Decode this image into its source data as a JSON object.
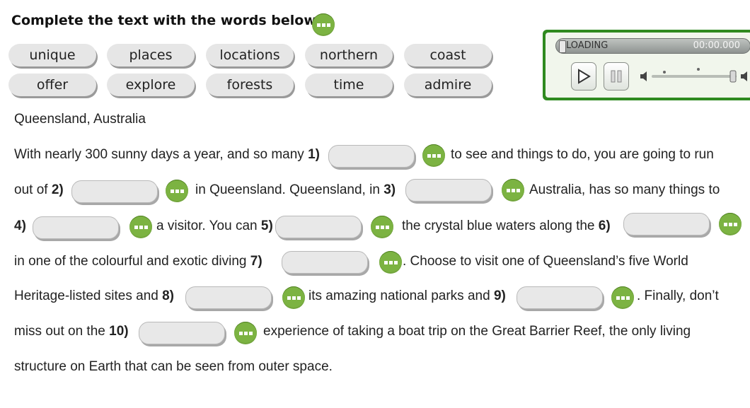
{
  "instruction": "Complete the text with the words below.",
  "word_bank": [
    [
      "unique",
      "places",
      "locations",
      "northern",
      "coast"
    ],
    [
      "offer",
      "explore",
      "forests",
      "time",
      "admire"
    ]
  ],
  "player": {
    "status": "LOADING",
    "time": "00:00.000"
  },
  "heading": "Queensland, Australia",
  "lines": {
    "l1": {
      "a": "With nearly 300 sunny days a year, and so many ",
      "n1": "1)",
      "b": "to see and things to do, you are going to run"
    },
    "l2": {
      "a": "out of ",
      "n2": "2)",
      "b": "in Queensland. Queensland, in ",
      "n3": "3)",
      "c": "Australia, has so many things to"
    },
    "l3": {
      "n4": "4)",
      "b": "a visitor. You can ",
      "n5": "5)",
      "c": "the crystal blue waters along the ",
      "n6": "6)"
    },
    "l4": {
      "a": "in one of the colourful and exotic diving ",
      "n7": "7)",
      "b": ". Choose to visit one of Queensland’s five World"
    },
    "l5": {
      "a": "Heritage-listed sites and ",
      "n8": "8)",
      "b": "its amazing national parks and ",
      "n9": "9)",
      "c": ". Finally, don’t"
    },
    "l6": {
      "a": "miss out on the ",
      "n10": "10)",
      "b": "experience of taking a boat trip on the Great Barrier Reef, the only living"
    },
    "l7": {
      "a": "structure on Earth that can be seen from outer space."
    }
  },
  "colors": {
    "accent_green": "#7cb342",
    "player_border": "#2f8a1f"
  }
}
